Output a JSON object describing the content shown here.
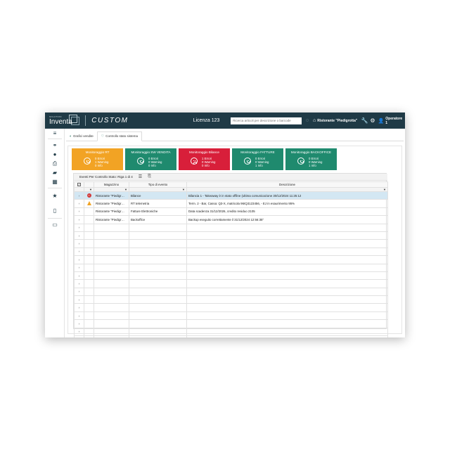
{
  "topbar": {
    "logo_small": "SOLUTION",
    "logo_text": "Inventa",
    "brand": "CUSTOM",
    "licenza": "Licenza 123",
    "search_placeholder": "Ricerca articoli per descrizione o barcode",
    "store": "Ristorante \"Piedigrotta\"",
    "user": "Operatore 1"
  },
  "tabs": [
    {
      "label": "Grafici vendite",
      "active": false
    },
    {
      "label": "Controllo stato sistema",
      "active": true
    }
  ],
  "tiles": [
    {
      "title": "Monitoraggio RT",
      "color": "#f2a324",
      "face": "smile",
      "line1": "0 Errori",
      "line2": "1 Warning",
      "line3": "0 Info"
    },
    {
      "title": "Monitoraggio SW VENDITA",
      "color": "#1f8a6e",
      "face": "smile",
      "line1": "0 Errori",
      "line2": "0 Warning",
      "line3": "0 Info"
    },
    {
      "title": "Monitoraggio Bilance",
      "color": "#d81f3a",
      "face": "frown",
      "line1": "1 Errori",
      "line2": "0 Warning",
      "line3": "0 Info"
    },
    {
      "title": "Monitoraggio FATTURE",
      "color": "#1f8a6e",
      "face": "smile",
      "line1": "0 Errori",
      "line2": "0 Warning",
      "line3": "1 Info"
    },
    {
      "title": "Monitoraggio BACKOFFICE",
      "color": "#1f8a6e",
      "face": "smile",
      "line1": "0 Errori",
      "line2": "0 Warning",
      "line3": "1 Info"
    }
  ],
  "grid": {
    "title": "Eventi Per Controllo Stato: Riga 1 di 4",
    "columns": [
      "Magazzino",
      "Tipo di evento",
      "Descrizione"
    ],
    "rows": [
      {
        "status": "error",
        "magazzino": "Ristorante \"Piedigr…",
        "tipo": "Bilance",
        "descrizione": "Bilancia 1 - Takeaway è in stato offline (ultima comunicazione 30/12/2024 11:25:12"
      },
      {
        "status": "warning",
        "magazzino": "Ristorante \"Piedigr…",
        "tipo": "RT telemetria",
        "descrizione": "Term. 2 - Bar, Cassa: Q3-X, matricola 96IQ3123456, - EJ in esaurimento 95%"
      },
      {
        "status": "none",
        "magazzino": "Ristorante \"Piedigr…",
        "tipo": "Fatture Elettroniche",
        "descrizione": "Data scadenza 31/12/2026, credito residuo 2105"
      },
      {
        "status": "none",
        "magazzino": "Ristorante \"Piedigr…",
        "tipo": "Backoffice",
        "descrizione": "Backup eseguito correttamente il 31/12/2024 12:56:35\""
      }
    ],
    "empty_rows": 15
  }
}
